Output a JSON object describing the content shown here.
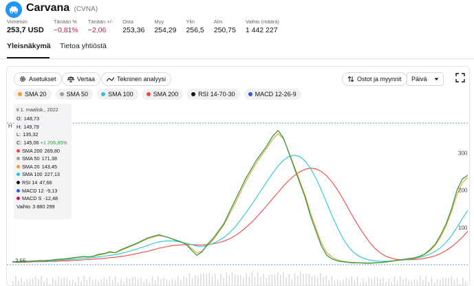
{
  "header": {
    "company": "Carvana",
    "ticker": "(CVNA)",
    "logo_icon": "car-icon",
    "brand_color": "#2196f3"
  },
  "stats": [
    {
      "label": "Viimeisin",
      "value": "253,7 USD",
      "style": "main"
    },
    {
      "label": "Tänään %",
      "value": "−0,81%",
      "style": "neg"
    },
    {
      "label": "Tänään +/-",
      "value": "−2,06",
      "style": "neg"
    },
    {
      "label": "Osta",
      "value": "253,36",
      "style": ""
    },
    {
      "label": "Myy",
      "value": "254,29",
      "style": ""
    },
    {
      "label": "Ylin",
      "value": "256,5",
      "style": ""
    },
    {
      "label": "Alin",
      "value": "250,75",
      "style": ""
    },
    {
      "label": "Vaihto (määrä)",
      "value": "1 442 227",
      "style": ""
    }
  ],
  "tabs": [
    {
      "label": "Yleisnäkymä",
      "active": true
    },
    {
      "label": "Tietoa yhtiöstä",
      "active": false
    }
  ],
  "toolbar": {
    "settings_label": "Asetukset",
    "compare_label": "Vertaa",
    "analysis_label": "Tekninen analyysi",
    "trades_label": "Ostot ja myynnit",
    "period_label": "Päivä"
  },
  "indicators": [
    {
      "label": "SMA 20",
      "color": "#f39c34"
    },
    {
      "label": "SMA 50",
      "color": "#9e9e9e"
    },
    {
      "label": "SMA 100",
      "color": "#26c6da"
    },
    {
      "label": "SMA 200",
      "color": "#f0483e"
    },
    {
      "label": "RSI 14-70-30",
      "color": "#111111"
    },
    {
      "label": "MACD 12-26-9",
      "color": "#2f5bd6"
    }
  ],
  "legend": {
    "date": "ti 1. maalisk., 2022",
    "rows": [
      {
        "key": "O:",
        "value": "148,73",
        "dot": ""
      },
      {
        "key": "H:",
        "value": "149,79",
        "dot": ""
      },
      {
        "key": "L:",
        "value": "135,32",
        "dot": ""
      },
      {
        "key": "C:",
        "value": "145,06",
        "change": "+1 206,85%",
        "dot": ""
      },
      {
        "key": "SMA 200",
        "value": "269,80",
        "dot": "#f0483e"
      },
      {
        "key": "SMA 50",
        "value": "171,38",
        "dot": "#9e9e9e"
      },
      {
        "key": "SMA 20",
        "value": "143,45",
        "dot": "#f39c34"
      },
      {
        "key": "SMA 100",
        "value": "227,13",
        "dot": "#26c6da"
      },
      {
        "key": "RSI 14",
        "value": "47,66",
        "dot": "#111111"
      },
      {
        "key": "MACD 12",
        "value": "-9,13",
        "dot": "#2f5bd6"
      },
      {
        "key": "MACD S",
        "value": "-12,48",
        "dot": "#c2185b"
      },
      {
        "key": "Vaihto",
        "value": "3 880 299",
        "dot": ""
      }
    ]
  },
  "axis": {
    "y_labels": [
      "300",
      "200",
      "100"
    ],
    "left_marker": "H",
    "bottom_left": "3,55"
  },
  "chart_data": {
    "type": "line",
    "y_ticks": [
      100,
      200,
      300
    ],
    "ylim": [
      0,
      380
    ],
    "series": [
      {
        "name": "",
        "color": "#2e9c3f",
        "values": [
          8,
          8,
          10,
          9,
          10,
          11,
          11,
          12,
          14,
          15,
          16,
          18,
          20,
          22,
          21,
          23,
          28,
          30,
          35,
          32,
          40,
          46,
          52,
          58,
          65,
          72,
          76,
          80,
          76,
          72,
          66,
          62,
          55,
          40,
          25,
          35,
          55,
          70,
          90,
          110,
          140,
          170,
          200,
          230,
          255,
          280,
          300,
          320,
          345,
          360,
          340,
          300,
          260,
          220,
          180,
          130,
          90,
          50,
          25,
          15,
          10,
          8,
          6,
          5,
          5,
          4,
          4,
          5,
          6,
          8,
          10,
          12,
          14,
          16,
          18,
          22,
          28,
          40,
          55,
          80,
          110,
          150,
          200,
          230,
          240
        ]
      },
      {
        "name": "SMA 20",
        "color": "#f39c34",
        "values": [
          8,
          8,
          9,
          9,
          10,
          10,
          11,
          12,
          13,
          14,
          15,
          17,
          19,
          21,
          21,
          22,
          26,
          29,
          33,
          32,
          38,
          44,
          50,
          56,
          63,
          70,
          74,
          78,
          76,
          72,
          67,
          62,
          56,
          44,
          32,
          36,
          52,
          66,
          86,
          106,
          134,
          162,
          192,
          222,
          248,
          272,
          294,
          314,
          336,
          352,
          338,
          302,
          264,
          226,
          186,
          138,
          98,
          58,
          32,
          20,
          13,
          9,
          7,
          6,
          5,
          5,
          5,
          5,
          6,
          7,
          9,
          11,
          13,
          15,
          17,
          21,
          27,
          37,
          52,
          75,
          104,
          142,
          188,
          220,
          234
        ]
      },
      {
        "name": "SMA 100",
        "color": "#26c6da",
        "values": [
          8,
          8,
          8,
          9,
          9,
          9,
          10,
          10,
          11,
          12,
          13,
          14,
          15,
          17,
          18,
          19,
          21,
          23,
          25,
          27,
          30,
          34,
          38,
          42,
          47,
          52,
          57,
          61,
          63,
          64,
          63,
          61,
          58,
          54,
          50,
          49,
          52,
          57,
          64,
          73,
          85,
          100,
          118,
          138,
          158,
          180,
          202,
          224,
          245,
          265,
          280,
          290,
          294,
          290,
          278,
          258,
          232,
          200,
          165,
          130,
          98,
          70,
          48,
          32,
          22,
          16,
          12,
          10,
          9,
          9,
          10,
          11,
          12,
          14,
          16,
          19,
          23,
          28,
          36,
          46,
          60,
          78,
          100,
          124,
          146
        ]
      },
      {
        "name": "SMA 200",
        "color": "#f0483e",
        "values": [
          7,
          7,
          7,
          7,
          8,
          8,
          8,
          9,
          9,
          10,
          10,
          11,
          12,
          13,
          14,
          15,
          16,
          17,
          19,
          20,
          22,
          24,
          27,
          30,
          33,
          36,
          40,
          44,
          47,
          50,
          52,
          53,
          54,
          54,
          53,
          53,
          54,
          56,
          59,
          63,
          69,
          77,
          87,
          99,
          112,
          127,
          143,
          160,
          177,
          194,
          211,
          226,
          239,
          249,
          256,
          259,
          257,
          250,
          238,
          221,
          200,
          176,
          150,
          124,
          100,
          78,
          58,
          42,
          30,
          22,
          17,
          14,
          13,
          13,
          14,
          15,
          17,
          20,
          24,
          30,
          38,
          48,
          60,
          74,
          90
        ]
      }
    ]
  }
}
